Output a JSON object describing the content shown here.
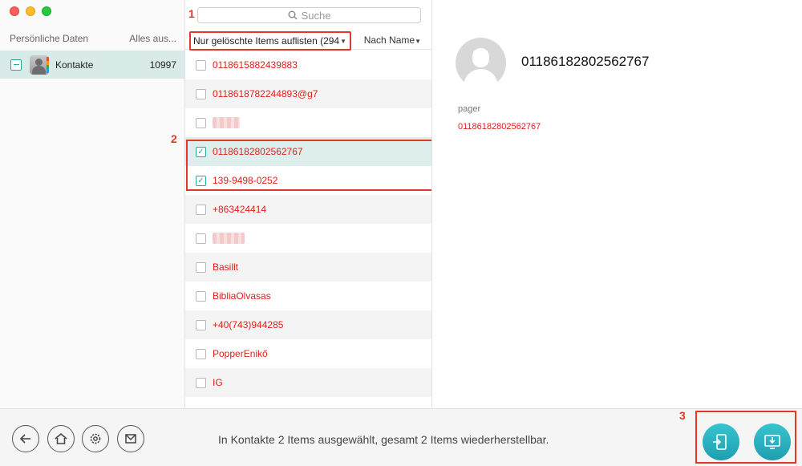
{
  "window": {
    "controls": [
      "close",
      "minimize",
      "zoom"
    ]
  },
  "sidebar": {
    "header_left": "Persönliche Daten",
    "header_right": "Alles aus...",
    "items": [
      {
        "label": "Kontakte",
        "count": "10997",
        "icon": "contacts-icon",
        "selected": true
      }
    ]
  },
  "list_panel": {
    "search_placeholder": "Suche",
    "filter_label": "Nur gelöschte Items auflisten (294",
    "sort_label": "Nach Name",
    "items": [
      {
        "name": "0118615882439883",
        "checked": false
      },
      {
        "name": "0118618782244893@g7",
        "checked": false
      },
      {
        "name": "",
        "checked": false,
        "redacted": true
      },
      {
        "name": "01186182802562767",
        "checked": true
      },
      {
        "name": "139-9498-0252",
        "checked": true
      },
      {
        "name": "+863424414",
        "checked": false
      },
      {
        "name": "",
        "checked": false,
        "redacted": true
      },
      {
        "name": "Basillt",
        "checked": false
      },
      {
        "name": "BibliaOlvasas",
        "checked": false
      },
      {
        "name": "+40(743)944285",
        "checked": false
      },
      {
        "name": "PopperEnikő",
        "checked": false
      },
      {
        "name": "IG",
        "checked": false
      }
    ]
  },
  "detail": {
    "name": "01186182802562767",
    "field_label": "pager",
    "field_value": "01186182802562767"
  },
  "bottom": {
    "status_text": "In Kontakte 2 Items ausgewählt, gesamt 2 Items wiederherstellbar.",
    "nav_icons": [
      "back-icon",
      "home-icon",
      "settings-icon",
      "mail-icon"
    ],
    "actions": [
      "to-device-icon",
      "to-computer-icon"
    ]
  },
  "annotations": {
    "marker_1": "1",
    "marker_2": "2",
    "marker_3": "3"
  },
  "colors": {
    "accent_teal": "#29a99a",
    "deleted_text": "#e0201b",
    "highlight_box": "#e2382a",
    "selected_row": "#ddeeec"
  }
}
